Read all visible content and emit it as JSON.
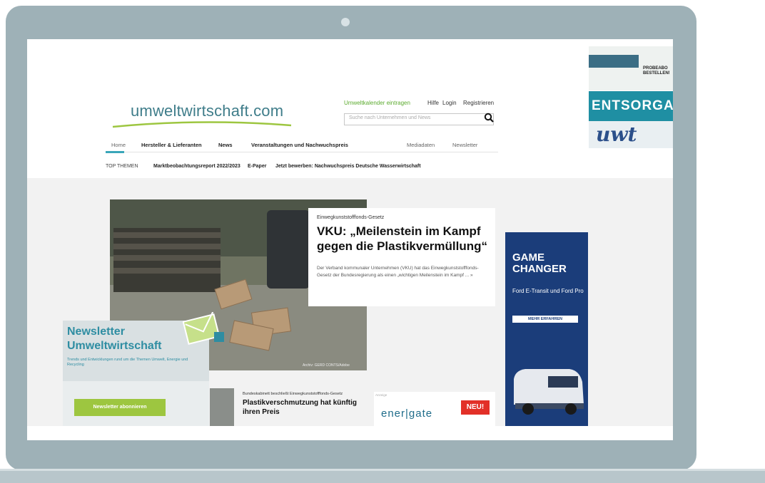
{
  "site": {
    "logo": "umweltwirtschaft.com"
  },
  "utility_nav": {
    "suggest": "Umweltkalender eintragen",
    "help": "Hilfe",
    "login": "Login",
    "register": "Registrieren"
  },
  "search": {
    "placeholder": "Suche nach Unternehmen und News"
  },
  "main_nav": {
    "items": [
      {
        "label": "Home"
      },
      {
        "label": "Hersteller & Lieferanten"
      },
      {
        "label": "News"
      },
      {
        "label": "Veranstaltungen und Nachwuchspreis"
      },
      {
        "label": "Mediadaten"
      },
      {
        "label": "Newsletter"
      }
    ]
  },
  "top_themes": {
    "label": "TOP THEMEN",
    "items": [
      {
        "label": "Marktbeobachtungsreport 2022/2023"
      },
      {
        "label": "E-Paper"
      },
      {
        "label": "Jetzt bewerben: Nachwuchspreis Deutsche Wasserwirtschaft"
      }
    ]
  },
  "ad_top": {
    "probe_text": "PROBEABO BESTELLEN!",
    "brand": "ENTSORGA",
    "brand2": "uwt"
  },
  "hero": {
    "kicker": "Einwegkunststofffonds-Gesetz",
    "title": "VKU: „Meilenstein im Kampf gegen die Plastikvermüllung“",
    "text": "Der Verband kommunaler Unternehmen (VKU) hat das Einwegkunststofffonds-Gesetz der Bundesregierung als einen „wichtigen Meilenstein im Kampf ... »",
    "credit": "Archiv: GERD CONTS/Adobe"
  },
  "ad_side": {
    "title": "GAME CHANGER",
    "subtitle": "Ford E-Transit und Ford Pro",
    "button": "MEHR ERFAHREN"
  },
  "newsletter": {
    "title": "Newsletter Umweltwirtschaft",
    "subtitle": "Trends und Entwicklungen rund um die Themen Umwelt, Energie und Recycling",
    "button": "Newsletter abonnieren"
  },
  "article2": {
    "kicker": "Bundeskabinett beschließt Einwegkunststofffonds-Gesetz",
    "title": "Plastikverschmutzung hat künftig ihren Preis"
  },
  "ad_energate": {
    "label": "Anzeige",
    "logo": "ener|gate",
    "badge": "NEU!"
  },
  "colors": {
    "laptop": "#9eb1b7",
    "accent": "#3aa6b9",
    "green": "#9dc640",
    "ad_blue": "#1b3d7a"
  }
}
